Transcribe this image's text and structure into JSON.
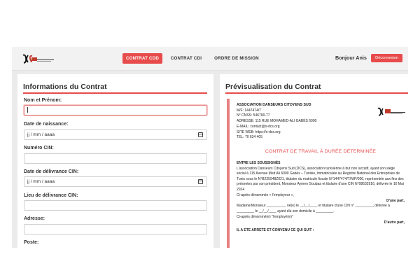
{
  "navbar": {
    "tabs": [
      {
        "label": "CONTRAT CDD",
        "active": true
      },
      {
        "label": "CONTRAT CDI",
        "active": false
      },
      {
        "label": "ORDRE DE MISSION",
        "active": false
      }
    ],
    "greeting": "Bonjour Anis",
    "logout_label": "Déconnexion",
    "accent_color": "#e84b4b"
  },
  "form": {
    "title": "Informations du Contrat",
    "fields": [
      {
        "label": "Nom et Prénom:",
        "value": "",
        "focused": true
      },
      {
        "label": "Date de naissance:",
        "value": "jj / mm / aaaa",
        "type": "date"
      },
      {
        "label": "Numéro CIN:",
        "value": ""
      },
      {
        "label": "Date de délivrance CIN:",
        "value": "jj / mm / aaaa",
        "type": "date"
      },
      {
        "label": "Lieu de délivrance CIN:",
        "value": ""
      },
      {
        "label": "Adresse:",
        "value": ""
      },
      {
        "label": "Poste:",
        "value": ""
      }
    ]
  },
  "preview": {
    "title": "Prévisualisation du Contrat",
    "org_name": "ASSOCIATION DANSEURS CITOYENS SUD",
    "org_lines": [
      "M/F: 1447474/T",
      "N° CNSS: 546790-77",
      "ADRESSE: 115 RUE MOHAMED-ALI GABÈS 6000",
      "E-MAIL: contact@o-dcs.org",
      "SITE WEB: https://o-dcs.org",
      "TEL: 70 634 405"
    ],
    "contract_title": "CONTRAT DE TRAVAIL À DURÉE DÉTERMINÉE",
    "section1": "ENTRE LES SOUSSIGNÉS",
    "para1": "L'association Danseurs Citoyens Sud (DCS), association tunisienne à but non lucratif, ayant son siège social à 115 Avenue Med Ali 6000 Gabès – Tunisie, immatriculée au Registre National des Entreprises de Tunis sous le N°B225948Z021, titulaire du matricule fiscale N°1447474/T/N/P/000, représentée aux fins des présentes par son président, Monsieur Aymen Goubaa et titulaire d'une CIN N°08632916, délivrée le 16 Mai 2024",
    "employer_note": "Ci-après dénommée « l'employeur »,",
    "one_part": "D'une part,",
    "para2_a": "Madame/Monsieur __________ né(e) le __/__/____ et titulaire d'une CIN n° _________, délivrée à",
    "para2_b": "_________ le __/__/____ ayant élu son domicile à _________.",
    "employee_note": "Ci-après dénommé(e) \"l'employé(e)\"",
    "other_part": "D'autre part,",
    "section2": "IL A ETE ARRETE ET CONVENU CE QUI SUIT :"
  }
}
